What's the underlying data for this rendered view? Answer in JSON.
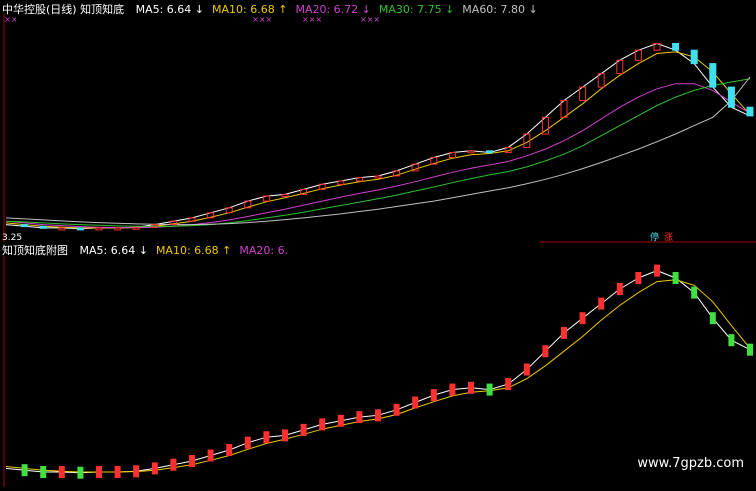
{
  "colors": {
    "background": "#000000",
    "ma5": "#ffffff",
    "ma10": "#f0c800",
    "ma20": "#d040d0",
    "ma30": "#30c030",
    "ma60": "#c0c0c0",
    "up_candle": "#ff3030",
    "down_candle": "#40e0f0",
    "down_bar": "#40e040",
    "axis": "#b00000",
    "marker_x": "#d040d0"
  },
  "top_panel": {
    "title": "中华控股(日线) 知顶知底",
    "ma": [
      {
        "label": "MA5: 6.64",
        "arrow": "↓",
        "color": "ma5"
      },
      {
        "label": "MA10: 6.68",
        "arrow": "↑",
        "color": "ma10"
      },
      {
        "label": "MA20: 6.72",
        "arrow": "↓",
        "color": "ma20"
      },
      {
        "label": "MA30: 7.75",
        "arrow": "↓",
        "color": "ma30"
      },
      {
        "label": "MA60: 7.80",
        "arrow": "↓",
        "color": "ma60"
      }
    ],
    "marks": [
      "××",
      "×××",
      "×××",
      "×××"
    ],
    "low_price_label": "3.25",
    "badges": [
      "停",
      "涨"
    ]
  },
  "bottom_panel": {
    "title": "知顶知底附图",
    "ma": [
      {
        "label": "MA5: 6.64",
        "arrow": "↓",
        "color": "ma5"
      },
      {
        "label": "MA10: 6.68",
        "arrow": "↑",
        "color": "ma10"
      },
      {
        "label": "MA20: 6.",
        "arrow": "",
        "color": "ma20"
      }
    ]
  },
  "watermark": "www.7gpzb.com",
  "chart_data": [
    {
      "type": "candlestick",
      "title": "中华控股(日线) 知顶知底",
      "series": [
        {
          "name": "MA5",
          "values": [
            3.4,
            3.35,
            3.3,
            3.3,
            3.28,
            3.3,
            3.3,
            3.32,
            3.4,
            3.5,
            3.6,
            3.75,
            3.9,
            4.1,
            4.25,
            4.3,
            4.45,
            4.6,
            4.7,
            4.8,
            4.85,
            5.0,
            5.2,
            5.4,
            5.55,
            5.6,
            5.55,
            5.7,
            6.1,
            6.6,
            7.1,
            7.5,
            7.9,
            8.3,
            8.6,
            8.8,
            8.6,
            8.2,
            7.5,
            6.9,
            6.64
          ]
        },
        {
          "name": "MA10",
          "values": [
            3.45,
            3.4,
            3.35,
            3.32,
            3.3,
            3.3,
            3.3,
            3.31,
            3.35,
            3.42,
            3.5,
            3.62,
            3.75,
            3.92,
            4.08,
            4.2,
            4.33,
            4.47,
            4.58,
            4.68,
            4.75,
            4.87,
            5.05,
            5.22,
            5.38,
            5.48,
            5.52,
            5.6,
            5.85,
            6.2,
            6.6,
            7.0,
            7.45,
            7.85,
            8.2,
            8.5,
            8.55,
            8.4,
            7.95,
            7.3,
            6.68
          ]
        },
        {
          "name": "MA20",
          "values": [
            3.5,
            3.45,
            3.4,
            3.37,
            3.34,
            3.32,
            3.31,
            3.31,
            3.32,
            3.35,
            3.4,
            3.46,
            3.54,
            3.64,
            3.75,
            3.86,
            3.98,
            4.1,
            4.22,
            4.33,
            4.43,
            4.55,
            4.68,
            4.82,
            4.96,
            5.08,
            5.18,
            5.28,
            5.45,
            5.65,
            5.9,
            6.2,
            6.55,
            6.9,
            7.2,
            7.45,
            7.6,
            7.6,
            7.4,
            7.05,
            6.72
          ]
        },
        {
          "name": "MA30",
          "values": [
            3.5,
            3.48,
            3.45,
            3.42,
            3.4,
            3.38,
            3.36,
            3.35,
            3.34,
            3.35,
            3.37,
            3.4,
            3.45,
            3.52,
            3.6,
            3.68,
            3.77,
            3.87,
            3.97,
            4.07,
            4.17,
            4.28,
            4.4,
            4.52,
            4.65,
            4.77,
            4.88,
            4.98,
            5.12,
            5.3,
            5.5,
            5.75,
            6.05,
            6.35,
            6.65,
            6.95,
            7.2,
            7.4,
            7.55,
            7.65,
            7.75
          ]
        },
        {
          "name": "MA60",
          "values": [
            3.6,
            3.57,
            3.54,
            3.51,
            3.48,
            3.46,
            3.44,
            3.42,
            3.41,
            3.4,
            3.4,
            3.41,
            3.43,
            3.46,
            3.5,
            3.55,
            3.6,
            3.66,
            3.72,
            3.79,
            3.86,
            3.94,
            4.02,
            4.1,
            4.2,
            4.3,
            4.4,
            4.5,
            4.62,
            4.75,
            4.9,
            5.07,
            5.25,
            5.45,
            5.65,
            5.87,
            6.1,
            6.35,
            6.6,
            7.1,
            7.8
          ]
        }
      ]
    },
    {
      "type": "line",
      "title": "知顶知底附图",
      "series": [
        {
          "name": "MA5",
          "values": [
            3.4,
            3.35,
            3.3,
            3.3,
            3.28,
            3.3,
            3.3,
            3.32,
            3.4,
            3.5,
            3.6,
            3.75,
            3.9,
            4.1,
            4.25,
            4.3,
            4.45,
            4.6,
            4.7,
            4.8,
            4.85,
            5.0,
            5.2,
            5.4,
            5.55,
            5.6,
            5.55,
            5.7,
            6.1,
            6.6,
            7.1,
            7.5,
            7.9,
            8.3,
            8.6,
            8.8,
            8.6,
            8.2,
            7.5,
            6.9,
            6.64
          ]
        },
        {
          "name": "MA10",
          "values": [
            3.45,
            3.4,
            3.35,
            3.32,
            3.3,
            3.3,
            3.3,
            3.31,
            3.35,
            3.42,
            3.5,
            3.62,
            3.75,
            3.92,
            4.08,
            4.2,
            4.33,
            4.47,
            4.58,
            4.68,
            4.75,
            4.87,
            5.05,
            5.22,
            5.38,
            5.48,
            5.52,
            5.6,
            5.85,
            6.2,
            6.6,
            7.0,
            7.45,
            7.85,
            8.2,
            8.5,
            8.55,
            8.4,
            7.95,
            7.3,
            6.68
          ]
        }
      ]
    }
  ]
}
